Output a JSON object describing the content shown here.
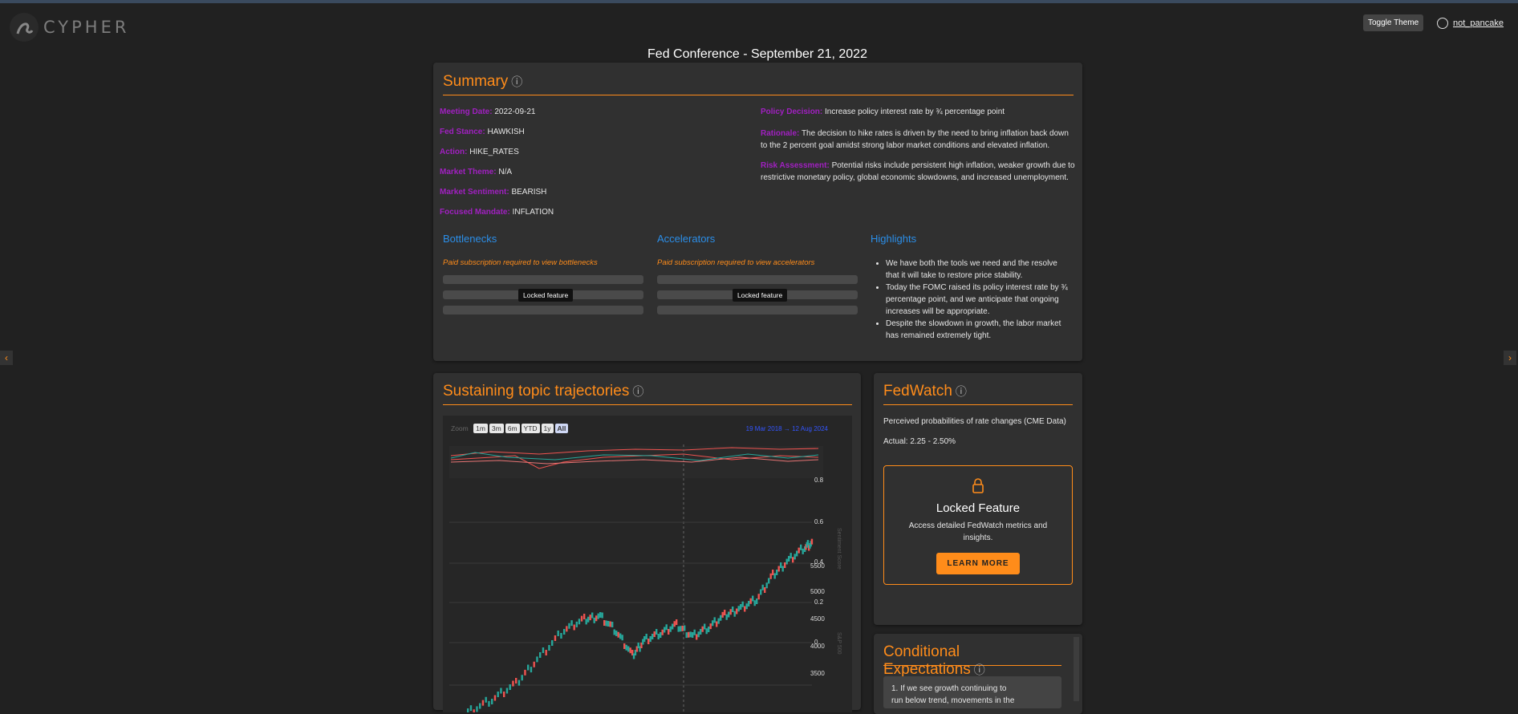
{
  "header": {
    "logo": "CYPHER",
    "toggle_theme": "Toggle Theme",
    "username": "not_pancake"
  },
  "page_title": "Fed Conference - September 21, 2022",
  "summary": {
    "title": "Summary",
    "info_icon": "ⓘ",
    "left": [
      {
        "label": "Meeting Date:",
        "value": "2022-09-21"
      },
      {
        "label": "Fed Stance:",
        "value": "HAWKISH"
      },
      {
        "label": "Action:",
        "value": "HIKE_RATES"
      },
      {
        "label": "Market Theme:",
        "value": "N/A"
      },
      {
        "label": "Market Sentiment:",
        "value": "BEARISH"
      },
      {
        "label": "Focused Mandate:",
        "value": "INFLATION"
      }
    ],
    "policy_decision": {
      "label": "Policy Decision:",
      "value": "Increase policy interest rate by ¾ percentage point"
    },
    "rationale": {
      "label": "Rationale:",
      "line1": "The decision to hike rates is driven by the need to bring inflation back down",
      "line2": "to the 2 percent goal amidst strong labor market conditions and elevated inflation."
    },
    "risk": {
      "label": "Risk Assessment:",
      "line1": "Potential risks include persistent high inflation, weaker growth due to",
      "line2": "restrictive monetary policy, global economic slowdowns, and increased unemployment."
    },
    "bottlenecks": {
      "title": "Bottlenecks",
      "paid": "Paid subscription required to view bottlenecks",
      "locked": "Locked feature"
    },
    "accelerators": {
      "title": "Accelerators",
      "paid": "Paid subscription required to view accelerators",
      "locked": "Locked feature"
    },
    "highlights": {
      "title": "Highlights",
      "items": [
        [
          "We have both the tools we need and the resolve",
          "that it will take to restore price stability."
        ],
        [
          "Today the FOMC raised its policy interest rate by ¾",
          "percentage point, and we anticipate that ongoing",
          "increases will be appropriate."
        ],
        [
          "Despite the slowdown in growth, the labor market",
          "has remained extremely tight."
        ]
      ]
    }
  },
  "trajectories": {
    "title": "Sustaining topic trajectories",
    "zoom_label": "Zoom",
    "zoom_buttons": [
      "1m",
      "3m",
      "6m",
      "YTD",
      "1y",
      "All"
    ],
    "range_from": "19 Mar 2018",
    "range_arrow": "→",
    "range_to": "12 Aug 2024",
    "sentiment_axis_label": "Sentiment Score",
    "sp_axis_label": "S&P 500",
    "sentiment_ticks": [
      "0.8",
      "0.6",
      "0.4",
      "0.2",
      "0"
    ],
    "sp_ticks": [
      "5500",
      "5000",
      "4500",
      "4000",
      "3500"
    ]
  },
  "fedwatch": {
    "title": "FedWatch",
    "subtitle": "Perceived probabilities of rate changes (CME Data)",
    "actual": "Actual: 2.25 - 2.50%",
    "locked_title": "Locked Feature",
    "locked_desc1": "Access detailed FedWatch metrics and",
    "locked_desc2": "insights.",
    "learn_more": "LEARN MORE"
  },
  "conditional": {
    "title": "Conditional Expectations",
    "item1_line1": "1. If we see growth continuing to",
    "item1_line2": "run below trend, movements in the"
  },
  "colors": {
    "accent": "#ff8c1a",
    "label": "#a020c0",
    "link": "#2b8ee8",
    "up": "#26a69a",
    "down": "#ef5350"
  }
}
